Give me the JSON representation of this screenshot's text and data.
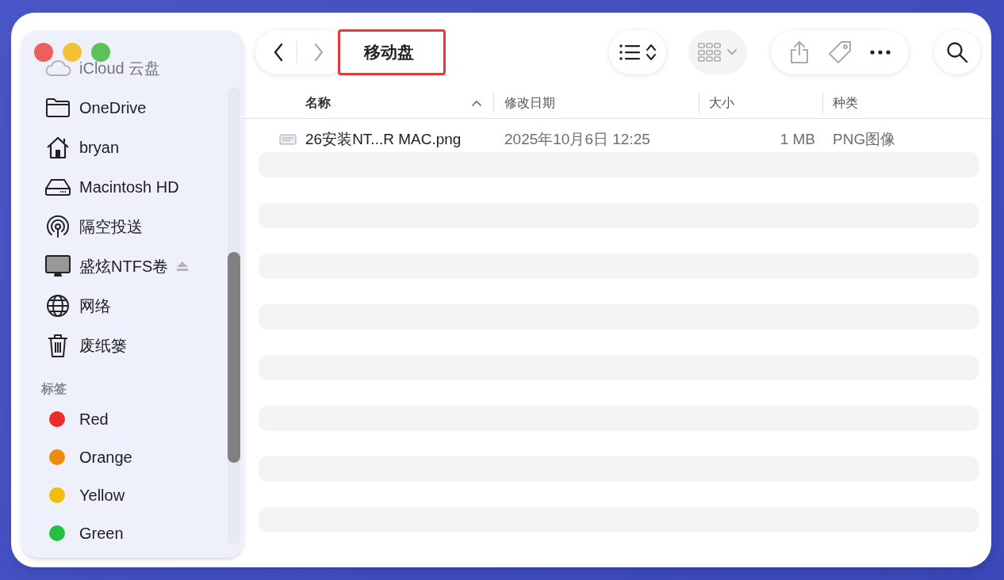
{
  "sidebar": {
    "items": [
      {
        "label": "iCloud 云盘",
        "faded": true
      },
      {
        "label": "OneDrive"
      },
      {
        "label": "bryan"
      },
      {
        "label": "Macintosh HD"
      },
      {
        "label": "隔空投送"
      },
      {
        "label": "盛炫NTFS卷",
        "ejectable": true
      },
      {
        "label": "网络"
      },
      {
        "label": "废纸篓"
      }
    ],
    "tags_heading": "标签",
    "tags": [
      {
        "label": "Red",
        "color": "#ee2b2b"
      },
      {
        "label": "Orange",
        "color": "#ee8a0c"
      },
      {
        "label": "Yellow",
        "color": "#f0bd0a"
      },
      {
        "label": "Green",
        "color": "#22c043"
      }
    ]
  },
  "toolbar": {
    "title": "移动盘"
  },
  "table": {
    "columns": [
      {
        "label": "名称",
        "sorted": true
      },
      {
        "label": "修改日期",
        "sorted": false
      },
      {
        "label": "大小",
        "sorted": false
      },
      {
        "label": "种类",
        "sorted": false
      }
    ],
    "rows": [
      {
        "cells": [
          "26安装NT...R MAC.png",
          "2025年10月6日 12:25",
          "1 MB",
          "PNG图像"
        ]
      }
    ]
  }
}
